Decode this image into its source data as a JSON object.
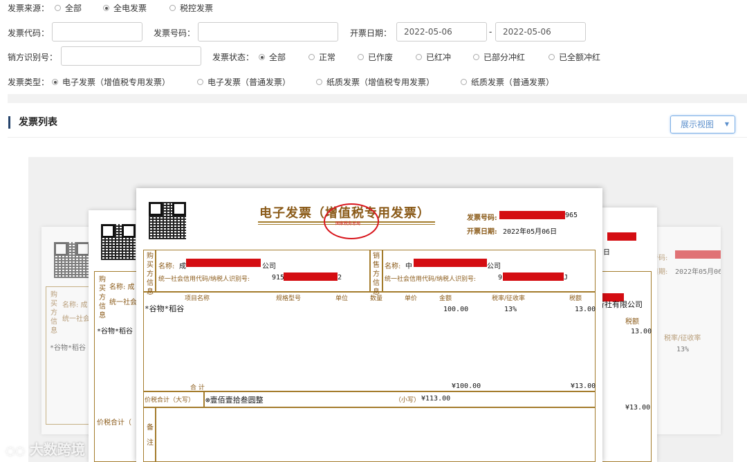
{
  "filters": {
    "source": {
      "label": "发票来源：",
      "options": [
        "全部",
        "全电发票",
        "税控发票"
      ],
      "selected": 1
    },
    "code": {
      "label": "发票代码：",
      "value": ""
    },
    "number": {
      "label": "发票号码：",
      "value": ""
    },
    "date": {
      "label": "开票日期：",
      "start": "2022-05-06",
      "sep": "-",
      "end": "2022-05-06"
    },
    "seller_id": {
      "label": "销方识别号：",
      "value": ""
    },
    "status": {
      "label": "发票状态：",
      "options": [
        "全部",
        "正常",
        "已作废",
        "已红冲",
        "已部分冲红",
        "已全额冲红"
      ],
      "selected": 0
    },
    "type": {
      "label": "发票类型：",
      "options": [
        "电子发票（增值税专用发票）",
        "电子发票（普通发票）",
        "纸质发票（增值税专用发票）",
        "纸质发票（普通发票）"
      ],
      "selected": 0
    }
  },
  "list": {
    "title": "发票列表",
    "view_button": "展示视图"
  },
  "invoice": {
    "title": "电子发票（增值税专用发票）",
    "no_label": "发票号码:",
    "no_suffix": "965",
    "date_label": "开票日期:",
    "date": "2022年05月06日",
    "stamp_text": "国家税务总局",
    "buyer_side": "购买方信息",
    "seller_side": "销售方信息",
    "buyer_name_label": "名称:",
    "buyer_name_prefix": "成",
    "buyer_name_suffix": "公司",
    "buyer_id_label": "统一社会信用代码/纳税人识别号:",
    "buyer_id_prefix": "915",
    "buyer_id_suffix": "2",
    "seller_name_label": "名称:",
    "seller_name_prefix": "中",
    "seller_name_suffix": "公司",
    "seller_id_label": "统一社会信用代码/纳税人识别号:",
    "seller_id_prefix": "9",
    "seller_id_suffix": "J",
    "headers": [
      "项目名称",
      "规格型号",
      "单位",
      "数量",
      "单价",
      "金额",
      "税率/征收率",
      "税额"
    ],
    "item_name": "*谷物*稻谷",
    "item_amount": "100.00",
    "item_rate": "13%",
    "item_tax": "13.00",
    "total_label": "合 计",
    "total_amount": "¥100.00",
    "total_tax": "¥13.00",
    "grand_label": "价税合计（大写）",
    "grand_upper": "⊗壹佰壹拾叁圆整",
    "grand_small_label": "（小写）",
    "grand_small": "¥113.00",
    "remark_label": "备注"
  },
  "back_cards": {
    "left_item": "*谷物*稻谷",
    "mid_item": "*谷物*稻谷",
    "mid_grand": "价税合计（",
    "right_date": "2022年05月06",
    "right_no_label": "发票号码:",
    "right_date_label": "开票日期:",
    "right_company": "銀行社有限公司",
    "right_rate_h": "税率/征收率",
    "right_tax_h": "税额",
    "right_rate": "13%",
    "right_tax": "13.00",
    "right_amount": "100.00",
    "right_tax2": "¥13.00",
    "right_fragment": "日"
  },
  "watermark": "大数跨境",
  "colors": {
    "accent": "#25436b",
    "gold": "#a37b2b",
    "redact": "#d40d12",
    "link": "#5b8fcc"
  }
}
